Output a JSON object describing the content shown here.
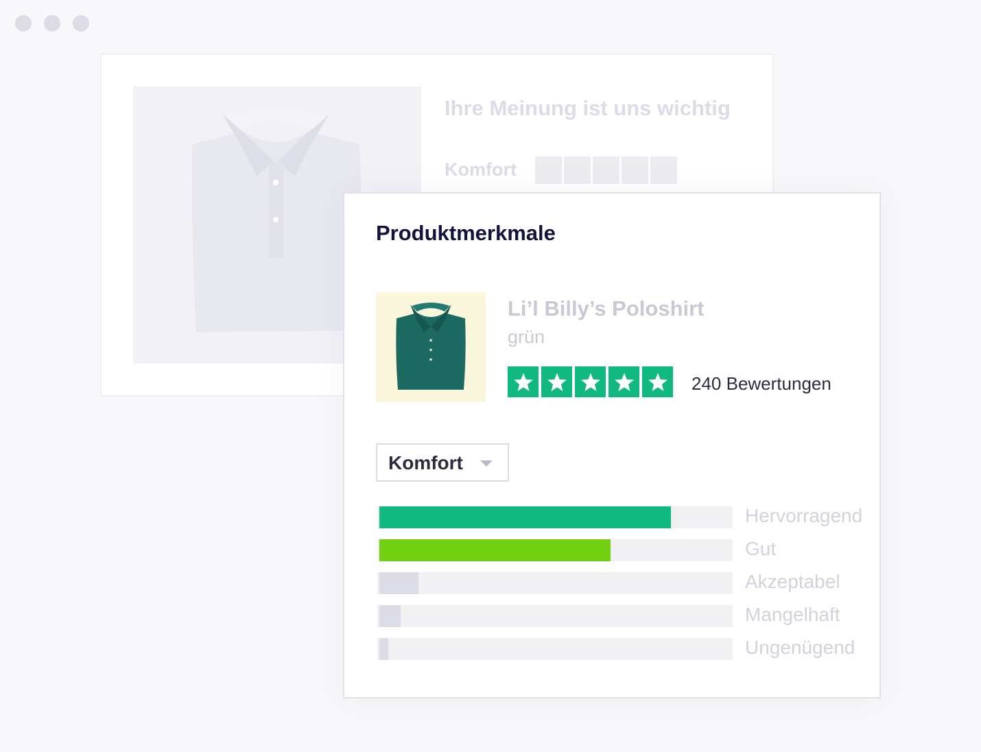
{
  "window": {
    "dots": [
      "dot-1",
      "dot-2",
      "dot-3"
    ]
  },
  "background_form": {
    "title": "Ihre Meinung ist uns wichtig",
    "rating_label": "Komfort",
    "star_slots": 5,
    "shirt_color": "#e8e8f0"
  },
  "product_features": {
    "title": "Produktmerkmale",
    "product": {
      "name": "Li’l Billy’s Poloshirt",
      "color_name": "grün",
      "shirt_color": "#1d6a63",
      "thumb_background": "#faf7dc"
    },
    "rating": {
      "stars": 5,
      "star_color": "#11b880",
      "review_count": "240 Bewertungen"
    },
    "dropdown": {
      "selected": "Komfort"
    },
    "distribution": [
      {
        "label": "Hervorragend",
        "fraction": 0.82,
        "color": "#11b880"
      },
      {
        "label": "Gut",
        "fraction": 0.65,
        "color": "#73cf11"
      },
      {
        "label": "Akzeptabel",
        "fraction": 0.11,
        "color": "#dcdce6"
      },
      {
        "label": "Mangelhaft",
        "fraction": 0.06,
        "color": "#dcdce6"
      },
      {
        "label": "Ungenügend",
        "fraction": 0.025,
        "color": "#dcdce6"
      }
    ]
  }
}
